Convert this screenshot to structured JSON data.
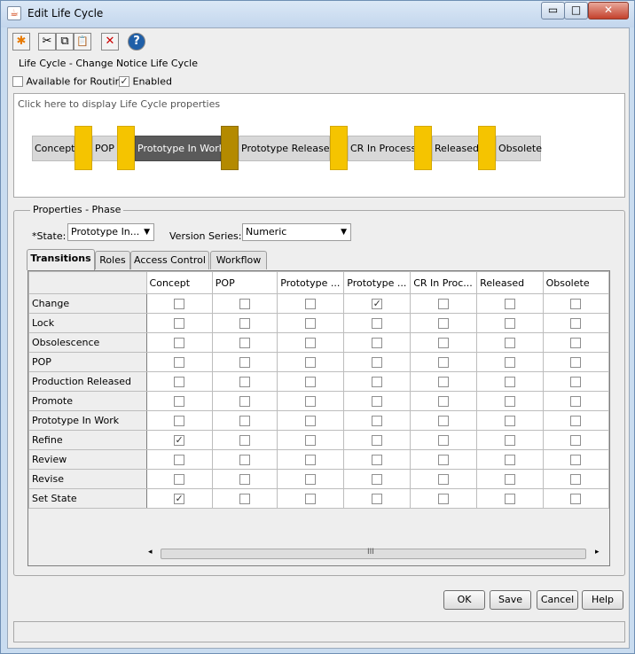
{
  "window": {
    "title": "Edit Life Cycle",
    "min_glyph": "▭",
    "max_glyph": "□",
    "close_glyph": "✕"
  },
  "toolbar": {
    "icons": [
      "new-icon",
      "cut-icon",
      "copy-icon",
      "paste-icon",
      "delete-icon",
      "help-icon"
    ],
    "glyphs": {
      "new": "✱",
      "cut": "✂",
      "copy": "⧉",
      "paste": "📋",
      "delete": "✕",
      "help": "?"
    },
    "colors": {
      "new": "#e87a00",
      "delete": "#cc0000",
      "help": "#1f5fa8"
    }
  },
  "lifecycle_label": "Life Cycle - Change Notice Life Cycle",
  "options": {
    "available_for_routing": {
      "label": "Available for Routing",
      "checked": false
    },
    "enabled": {
      "label": "Enabled",
      "checked": true
    }
  },
  "diagram": {
    "hint": "Click here to display Life Cycle properties",
    "stages": [
      "Concept",
      "POP",
      "Prototype In Work",
      "Prototype Released",
      "CR In Process",
      "Released",
      "Obsolete"
    ],
    "selected_stage": "Prototype In Work",
    "gate_color": "#f5c400",
    "selected_gate_color": "#b48a00"
  },
  "properties": {
    "title": "Properties - Phase",
    "state_label": "*State:",
    "state_value": "Prototype In...",
    "version_label": "Version Series:",
    "version_value": "Numeric",
    "dropdown_glyph": "▼"
  },
  "tabs": [
    "Transitions",
    "Roles",
    "Access Control",
    "Workflow"
  ],
  "active_tab": "Transitions",
  "transitions": {
    "columns": [
      "Concept",
      "POP",
      "Prototype ...",
      "Prototype ...",
      "CR In Proc...",
      "Released",
      "Obsolete"
    ],
    "rows": [
      {
        "name": "Change",
        "checks": [
          false,
          false,
          false,
          true,
          false,
          false,
          false
        ]
      },
      {
        "name": "Lock",
        "checks": [
          false,
          false,
          false,
          false,
          false,
          false,
          false
        ]
      },
      {
        "name": "Obsolescence",
        "checks": [
          false,
          false,
          false,
          false,
          false,
          false,
          false
        ]
      },
      {
        "name": "POP",
        "checks": [
          false,
          false,
          false,
          false,
          false,
          false,
          false
        ]
      },
      {
        "name": "Production Released",
        "checks": [
          false,
          false,
          false,
          false,
          false,
          false,
          false
        ]
      },
      {
        "name": "Promote",
        "checks": [
          false,
          false,
          false,
          false,
          false,
          false,
          false
        ]
      },
      {
        "name": "Prototype In Work",
        "checks": [
          false,
          false,
          false,
          false,
          false,
          false,
          false
        ]
      },
      {
        "name": "Refine",
        "checks": [
          true,
          false,
          false,
          false,
          false,
          false,
          false
        ]
      },
      {
        "name": "Review",
        "checks": [
          false,
          false,
          false,
          false,
          false,
          false,
          false
        ]
      },
      {
        "name": "Revise",
        "checks": [
          false,
          false,
          false,
          false,
          false,
          false,
          false
        ]
      },
      {
        "name": "Set State",
        "checks": [
          true,
          false,
          false,
          false,
          false,
          false,
          false
        ]
      }
    ],
    "scroll": {
      "left": "◂",
      "right": "▸",
      "grip": "III"
    }
  },
  "buttons": {
    "ok": "OK",
    "save": "Save",
    "cancel": "Cancel",
    "help": "Help"
  },
  "status": ""
}
